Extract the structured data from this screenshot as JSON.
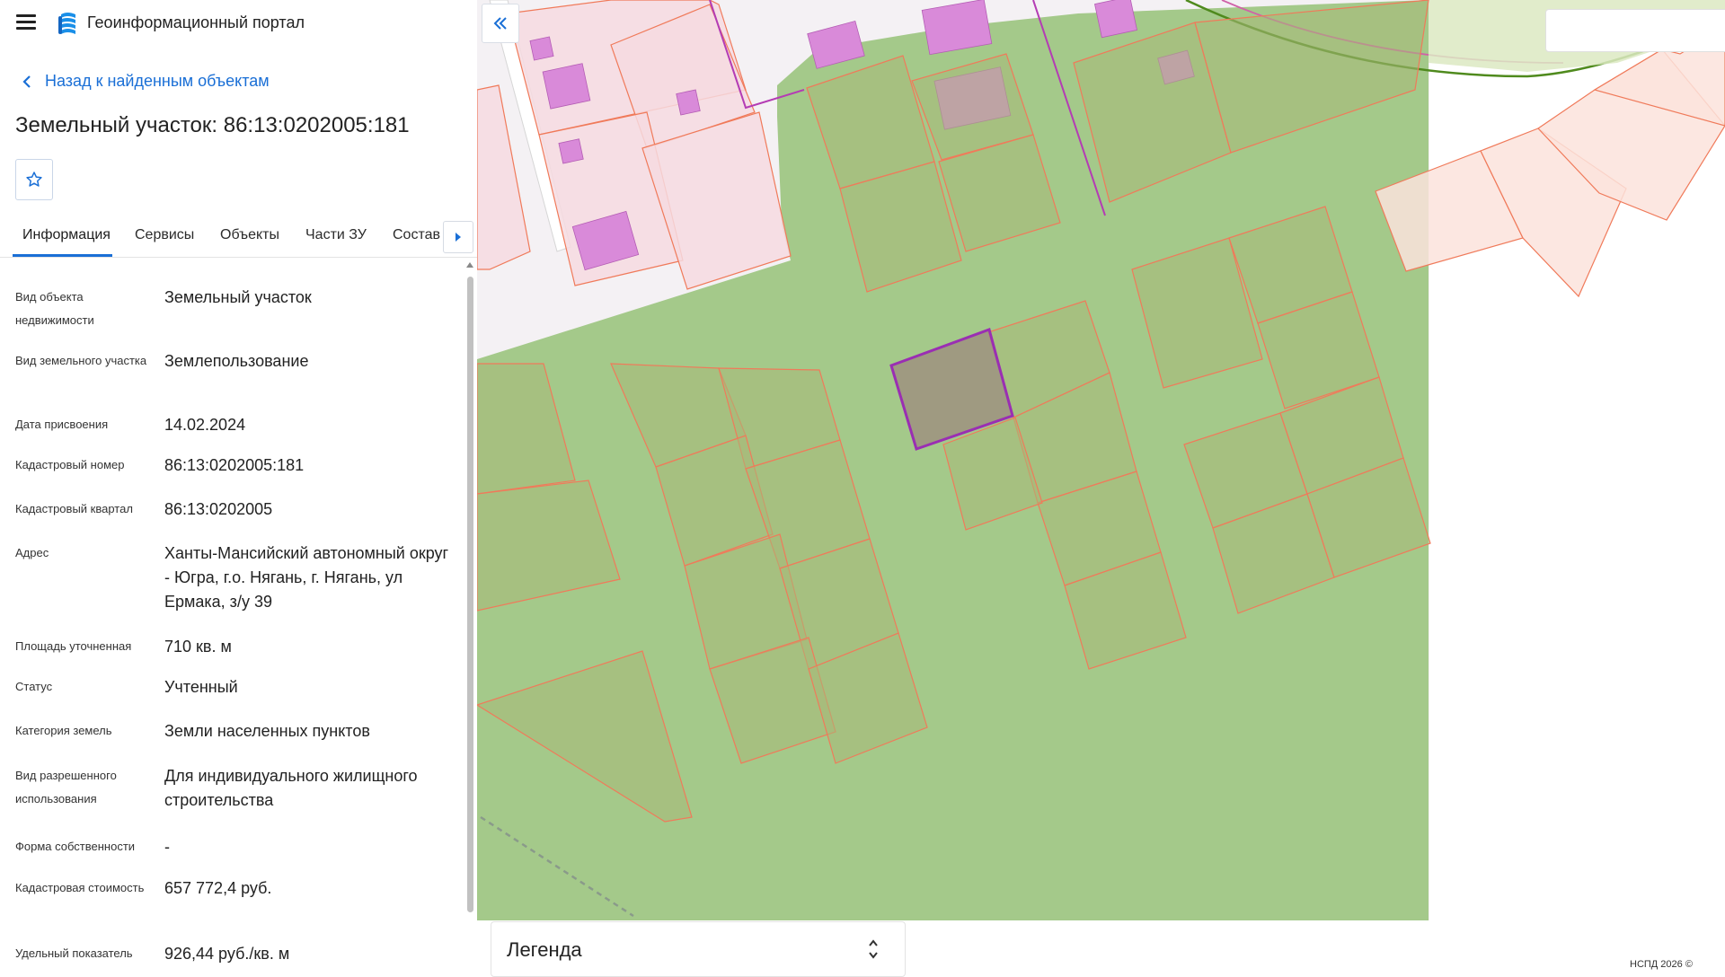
{
  "header": {
    "app_title": "Геоинформационный портал",
    "menu_icon": "hamburger-menu-icon",
    "logo_icon": "portal-logo-icon"
  },
  "navigation": {
    "back_label": "Назад к найденным объектам"
  },
  "object": {
    "title": "Земельный участок: 86:13:0202005:181"
  },
  "colors": {
    "accent": "#1a6fd6",
    "green_zone": "#a4c98a",
    "parcel_stroke": "#f07a5a",
    "building": "#d98ad9",
    "selected_parcel": "#9a2eb3"
  },
  "tabs": [
    {
      "label": "Информация",
      "active": true
    },
    {
      "label": "Сервисы",
      "active": false
    },
    {
      "label": "Объекты",
      "active": false
    },
    {
      "label": "Части ЗУ",
      "active": false
    },
    {
      "label": "Состав",
      "active": false
    }
  ],
  "details": [
    {
      "label": "Вид объекта недвижимости",
      "value": "Земельный участок"
    },
    {
      "label": "Вид земельного участка",
      "value": "Землепользование"
    },
    {
      "label": "Дата присвоения",
      "value": "14.02.2024"
    },
    {
      "label": "Кадастровый номер",
      "value": "86:13:0202005:181"
    },
    {
      "label": "Кадастровый квартал",
      "value": "86:13:0202005"
    },
    {
      "label": "Адрес",
      "value": "Ханты-Мансийский автономный округ - Югра, г.о. Нягань, г. Нягань, ул Ермака, з/у 39"
    },
    {
      "label": "Площадь уточненная",
      "value": "710 кв. м"
    },
    {
      "label": "Статус",
      "value": "Учтенный"
    },
    {
      "label": "Категория земель",
      "value": "Земли населенных пунктов"
    },
    {
      "label": "Вид разрешенного использования",
      "value": "Для индивидуального жилищного строительства"
    },
    {
      "label": "Форма собственности",
      "value": "-"
    },
    {
      "label": "Кадастровая стоимость",
      "value": "657 772,4 руб."
    },
    {
      "label": "Удельный показатель",
      "value": "926,44 руб./кв. м"
    }
  ],
  "map": {
    "legend_label": "Легенда",
    "attribution": "НСПД 2026 ©"
  }
}
